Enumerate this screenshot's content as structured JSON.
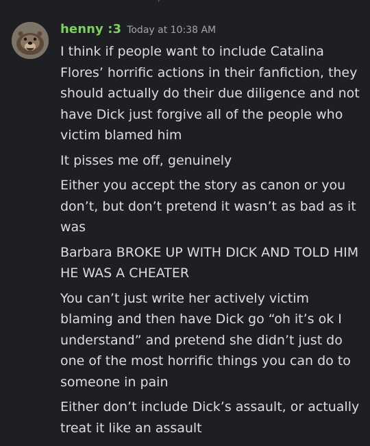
{
  "message": {
    "username": "henny :3",
    "timestamp": "Today at 10:38 AM",
    "username_color": "#7bd25a",
    "avatar_icon": "otter-avatar",
    "lines": [
      "I think if people want to include Catalina Flores’ horrific actions in their fanfiction, they should actually do their due diligence and not have Dick just forgive all of the people who victim blamed him",
      "It pisses me off, genuinely",
      "Either you accept the story as canon or you don’t, but don’t pretend it wasn’t as bad as it was",
      "Barbara BROKE UP WITH DICK AND TOLD HIM HE WAS A CHEATER",
      "You can’t just write her actively victim blaming and then have Dick go “oh it’s ok I understand” and pretend she didn’t just do one of the most horrific things you can do to someone in pain",
      "Either don’t include Dick’s assault, or actually treat it like an assault"
    ]
  },
  "colors": {
    "background": "#1e1f22",
    "text": "#dcdde0",
    "timestamp": "#a3a6ad"
  }
}
